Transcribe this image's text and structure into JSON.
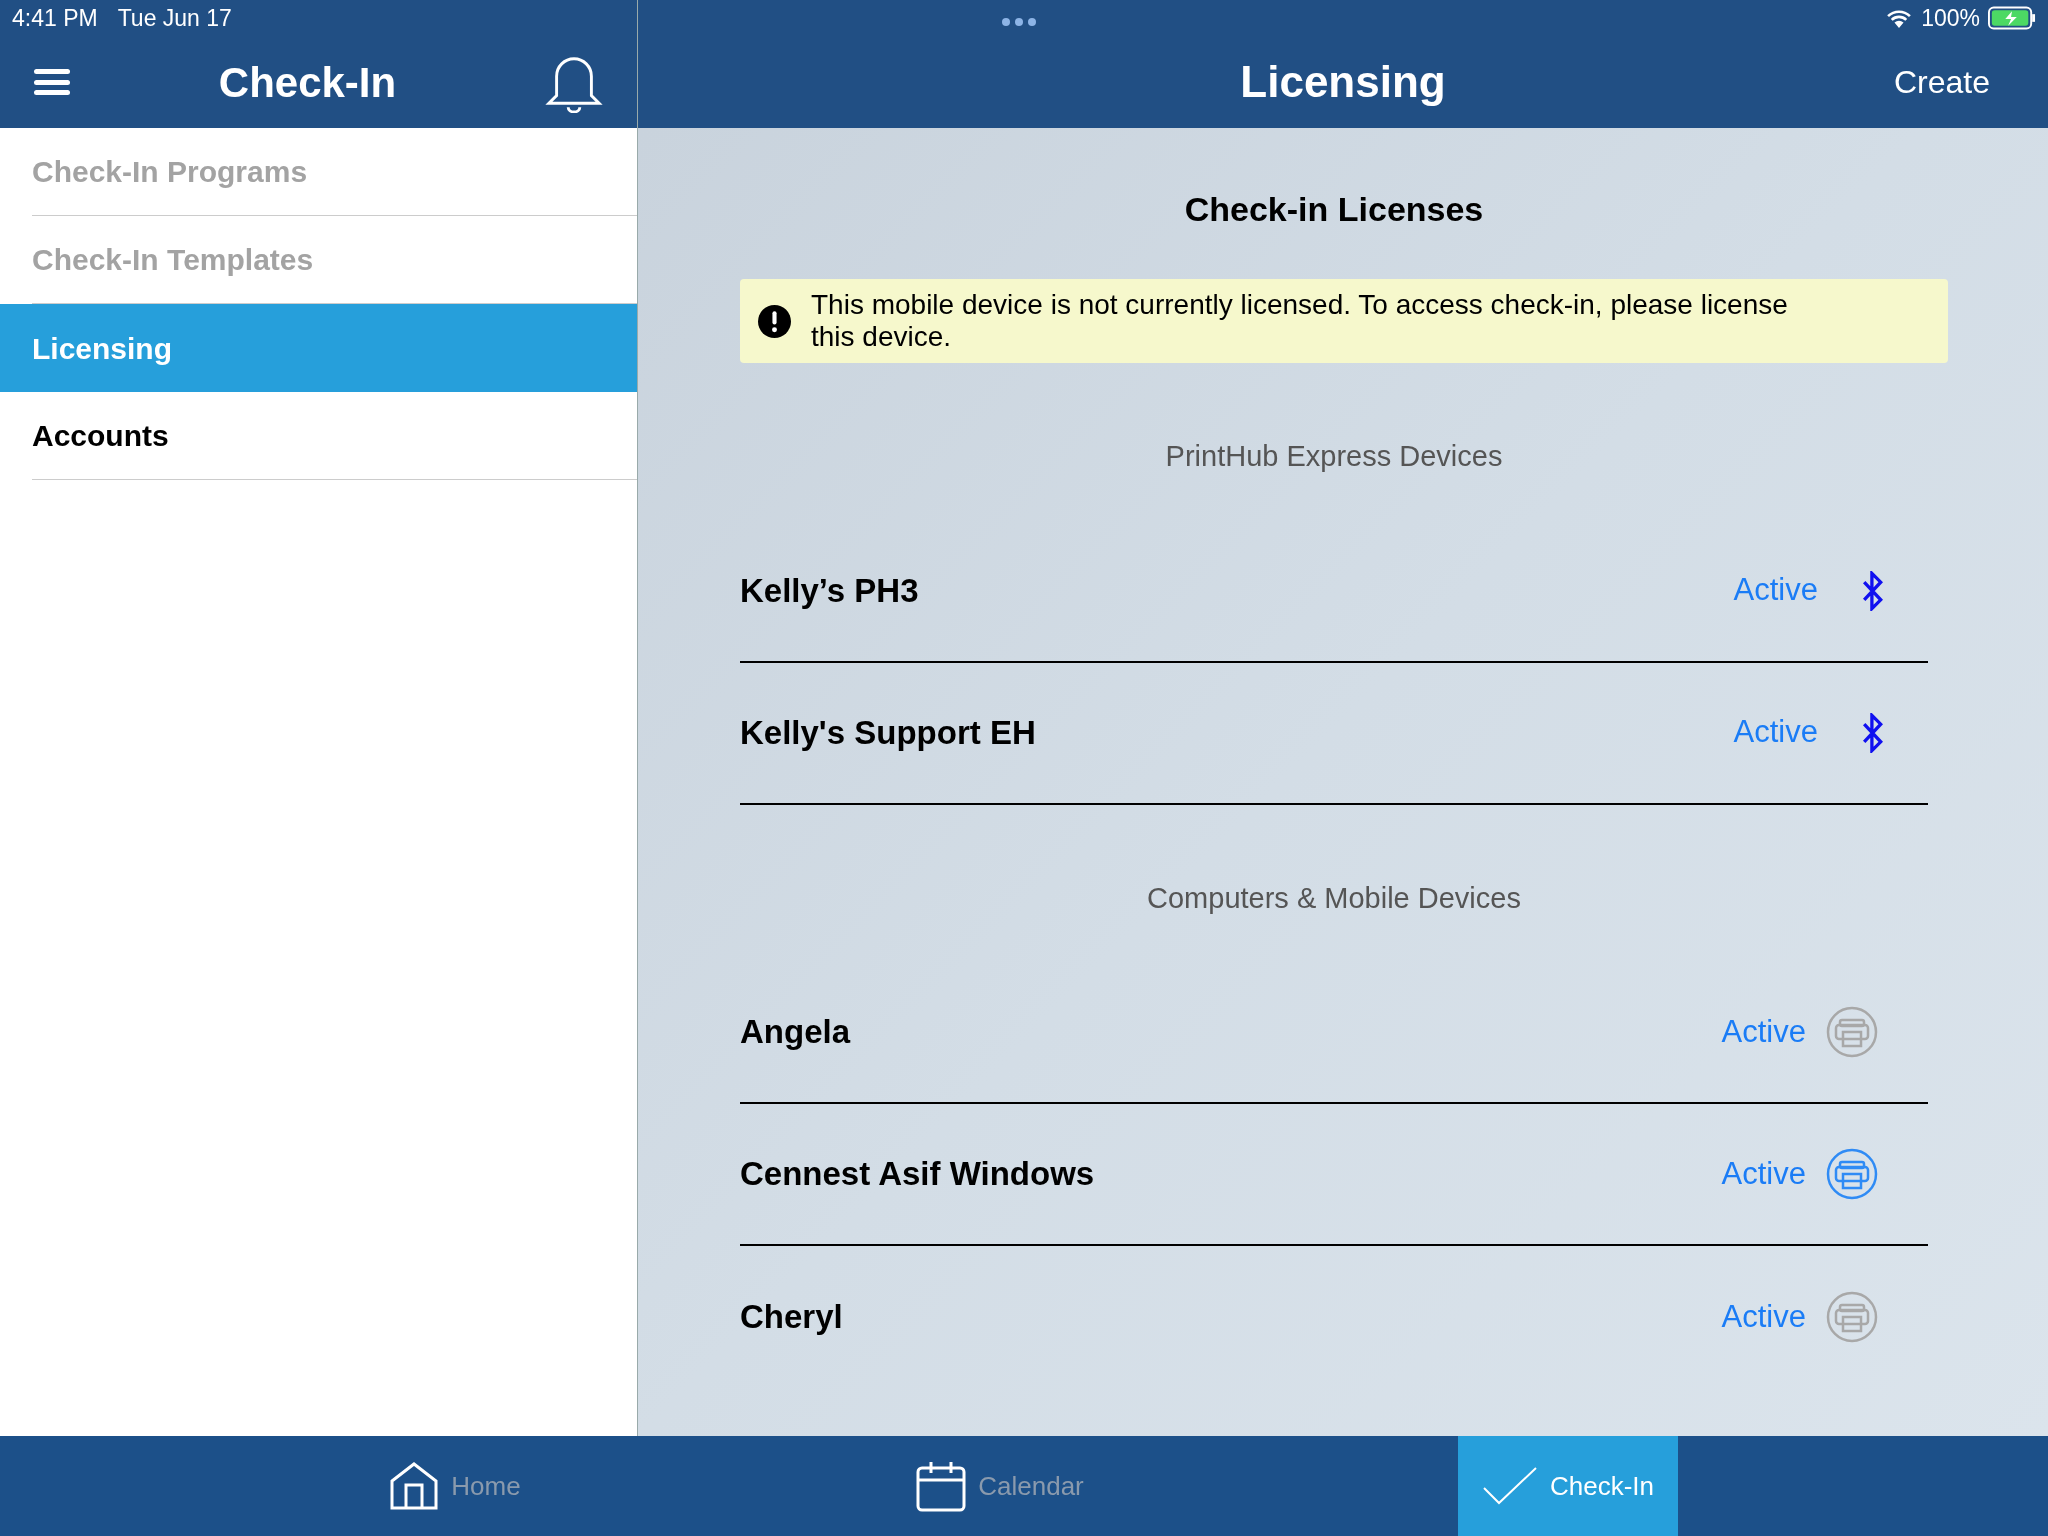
{
  "status_bar": {
    "time": "4:41 PM",
    "date": "Tue Jun 17",
    "battery": "100%"
  },
  "sidebar": {
    "title": "Check-In",
    "items": [
      {
        "label": "Check-In Programs",
        "selected": false,
        "disabled": true
      },
      {
        "label": "Check-In Templates",
        "selected": false,
        "disabled": true
      },
      {
        "label": "Licensing",
        "selected": true,
        "disabled": false
      },
      {
        "label": "Accounts",
        "selected": false,
        "disabled": false
      }
    ]
  },
  "header": {
    "title": "Licensing",
    "action": "Create"
  },
  "page_title": "Check-in Licenses",
  "alert": "This mobile device is not currently licensed. To access check-in, please license this device.",
  "sections": [
    {
      "title": "PrintHub Express Devices",
      "kind": "bluetooth",
      "devices": [
        {
          "name": "Kelly’s PH3",
          "status": "Active"
        },
        {
          "name": "Kelly's Support EH",
          "status": "Active"
        }
      ]
    },
    {
      "title": "Computers & Mobile Devices",
      "kind": "printer",
      "devices": [
        {
          "name": "Angela",
          "status": "Active",
          "selected": false
        },
        {
          "name": "Cennest Asif Windows",
          "status": "Active",
          "selected": true
        },
        {
          "name": "Cheryl",
          "status": "Active",
          "selected": false
        }
      ]
    }
  ],
  "tab_bar": [
    {
      "label": "Home",
      "kind": "home",
      "selected": false
    },
    {
      "label": "Calendar",
      "kind": "calendar",
      "selected": false
    },
    {
      "label": "Check-In",
      "kind": "check",
      "selected": true
    }
  ]
}
